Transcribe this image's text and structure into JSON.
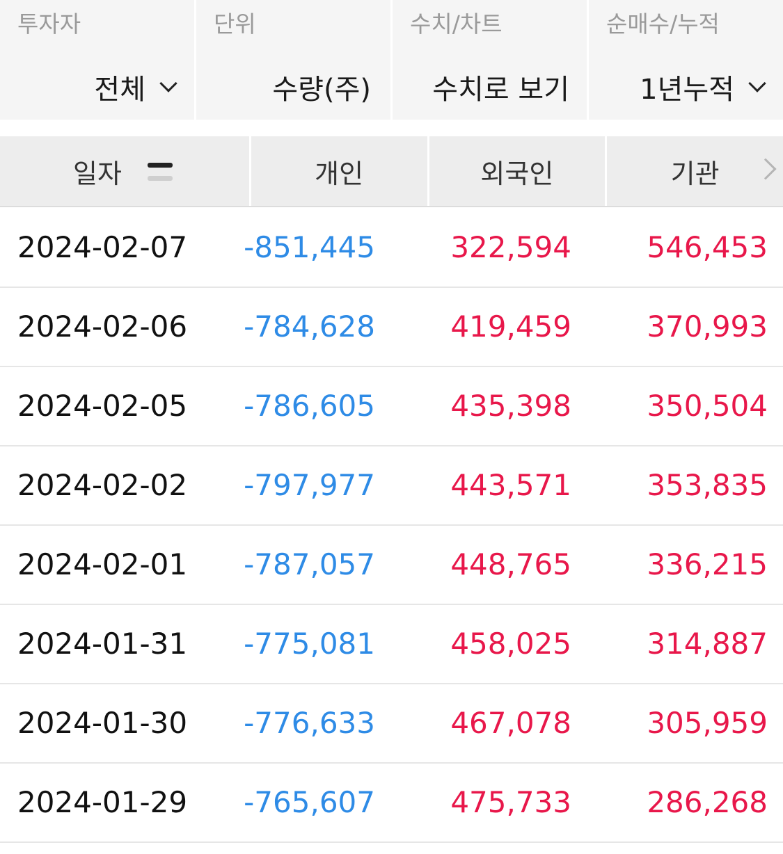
{
  "filters": [
    {
      "label": "투자자",
      "value": "전체",
      "dropdown": true
    },
    {
      "label": "단위",
      "value": "수량(주)",
      "dropdown": false
    },
    {
      "label": "수치/차트",
      "value": "수치로 보기",
      "dropdown": false
    },
    {
      "label": "순매수/누적",
      "value": "1년누적",
      "dropdown": true
    }
  ],
  "table": {
    "headers": [
      "일자",
      "개인",
      "외국인",
      "기관"
    ],
    "rows": [
      {
        "date": "2024-02-07",
        "individual": "-851,445",
        "foreign": "322,594",
        "institution": "546,453"
      },
      {
        "date": "2024-02-06",
        "individual": "-784,628",
        "foreign": "419,459",
        "institution": "370,993"
      },
      {
        "date": "2024-02-05",
        "individual": "-786,605",
        "foreign": "435,398",
        "institution": "350,504"
      },
      {
        "date": "2024-02-02",
        "individual": "-797,977",
        "foreign": "443,571",
        "institution": "353,835"
      },
      {
        "date": "2024-02-01",
        "individual": "-787,057",
        "foreign": "448,765",
        "institution": "336,215"
      },
      {
        "date": "2024-01-31",
        "individual": "-775,081",
        "foreign": "458,025",
        "institution": "314,887"
      },
      {
        "date": "2024-01-30",
        "individual": "-776,633",
        "foreign": "467,078",
        "institution": "305,959"
      },
      {
        "date": "2024-01-29",
        "individual": "-765,607",
        "foreign": "475,733",
        "institution": "286,268"
      }
    ]
  },
  "colors": {
    "negative": "#2e8be6",
    "positive": "#e8174a"
  },
  "icons": {
    "sort": "sort-icon",
    "dropdown": "chevron-down-icon",
    "next": "chevron-right-icon"
  }
}
